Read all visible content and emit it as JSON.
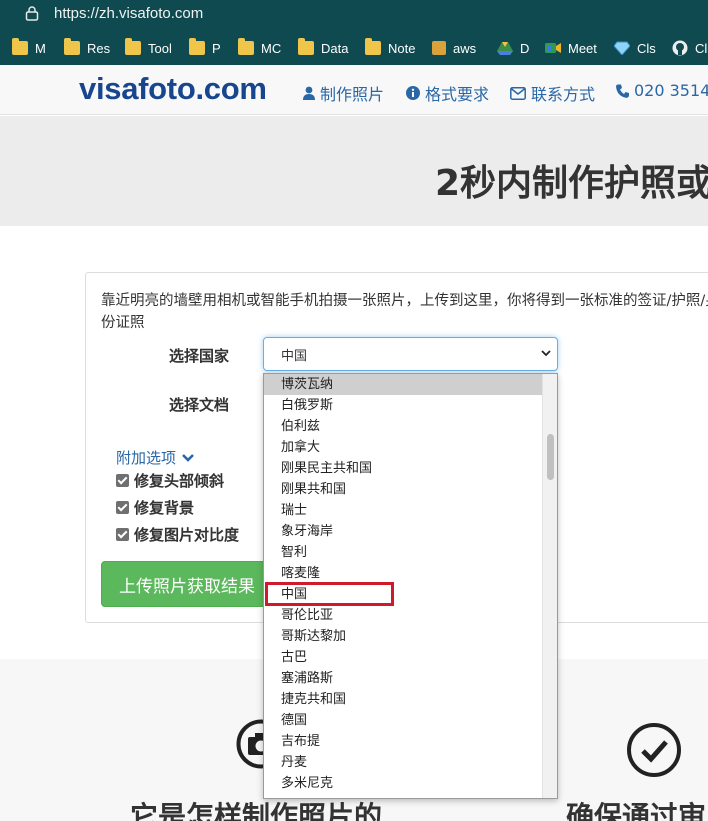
{
  "browser": {
    "url": "https://zh.visafoto.com",
    "bookmarks": [
      {
        "label": "M",
        "icon": "folder-icon"
      },
      {
        "label": "Res",
        "icon": "folder-icon"
      },
      {
        "label": "Tool",
        "icon": "folder-icon"
      },
      {
        "label": "P",
        "icon": "folder-icon"
      },
      {
        "label": "MC",
        "icon": "folder-icon"
      },
      {
        "label": "Data",
        "icon": "folder-icon"
      },
      {
        "label": "Note",
        "icon": "folder-icon"
      },
      {
        "label": "aws",
        "icon": "box-icon"
      },
      {
        "label": "D",
        "icon": "drive-icon"
      },
      {
        "label": "Meet",
        "icon": "meet-icon"
      },
      {
        "label": "Cls",
        "icon": "diamond-icon"
      },
      {
        "label": "Cl",
        "icon": "github-icon"
      }
    ]
  },
  "header": {
    "logo": "visafoto.com",
    "nav": [
      {
        "label": "制作照片",
        "icon": "user-icon"
      },
      {
        "label": "格式要求",
        "icon": "info-icon"
      },
      {
        "label": "联系方式",
        "icon": "mail-icon"
      },
      {
        "label": "020 3514",
        "icon": "phone-icon"
      }
    ]
  },
  "hero": {
    "title": "2秒内制作护照或"
  },
  "form": {
    "intro": "靠近明亮的墙壁用相机或智能手机拍摄一张照片，上传到这里，你将得到一张标准的签证/护照/身份证照",
    "country_label": "选择国家",
    "country_value": "中国",
    "document_label": "选择文档",
    "extra_options": "附加选项",
    "checkboxes": [
      {
        "label": "修复头部倾斜",
        "checked": true
      },
      {
        "label": "修复背景",
        "checked": true
      },
      {
        "label": "修复图片对比度",
        "checked": true
      }
    ],
    "upload_button": "上传照片获取结果"
  },
  "dropdown": {
    "options": [
      "博茨瓦纳",
      "白俄罗斯",
      "伯利兹",
      "加拿大",
      "刚果民主共和国",
      "刚果共和国",
      "瑞士",
      "象牙海岸",
      "智利",
      "喀麦隆",
      "中国",
      "哥伦比亚",
      "哥斯达黎加",
      "古巴",
      "塞浦路斯",
      "捷克共和国",
      "德国",
      "吉布提",
      "丹麦",
      "多米尼克"
    ],
    "highlighted": "博茨瓦纳",
    "annotated": "中国"
  },
  "features": [
    {
      "title": "它是怎样制作照片的",
      "icon": "camera-icon"
    },
    {
      "title": "确保通过审",
      "icon": "check-circle-icon"
    }
  ],
  "colors": {
    "brand": "#17468e",
    "link": "#2a67a6",
    "success": "#5cb85c",
    "annotation": "#d0192a",
    "browser_chrome": "#0e4a50"
  }
}
